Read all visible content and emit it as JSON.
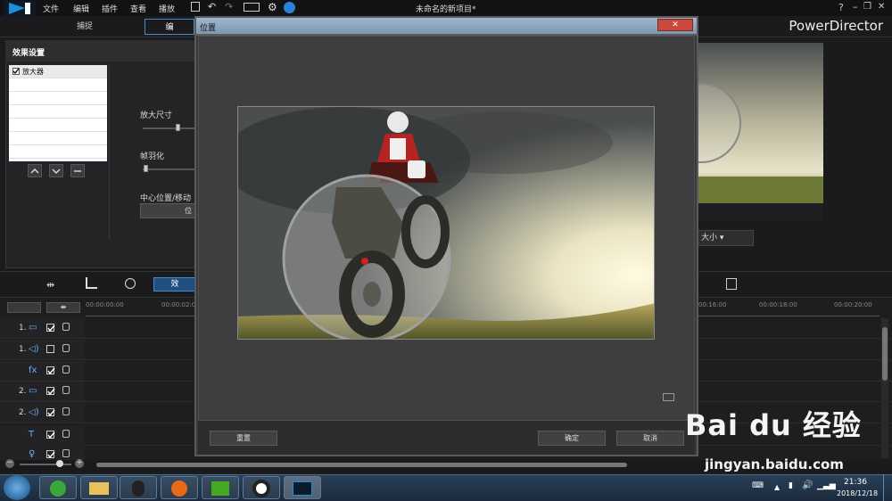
{
  "app": {
    "name": "PowerDirector",
    "title": "未命名的新项目*"
  },
  "menu": [
    "文件",
    "编辑",
    "插件",
    "查看",
    "播放"
  ],
  "tabs": [
    {
      "label": "捕捉"
    },
    {
      "label": "编"
    }
  ],
  "effects_panel": {
    "header": "效果设置",
    "list": [
      {
        "label": "放大器",
        "checked": true
      }
    ],
    "params": {
      "size_label": "放大尺寸",
      "feather_label": "帧羽化",
      "center_label": "中心位置/移动",
      "center_button": "位"
    },
    "list_buttons": [
      "up-icon",
      "down-icon",
      "remove-icon"
    ]
  },
  "preview": {
    "size_dropdown": "大小"
  },
  "toolbar": {
    "effect_tab": "效"
  },
  "timeline": {
    "ruler": [
      "00:00:00:00",
      "00:00:02:0",
      "00:16:00",
      "00:00:18:00",
      "00:00:20:00"
    ],
    "tracks": [
      {
        "num": "1.",
        "icon": "video-icon",
        "checked": true
      },
      {
        "num": "1.",
        "icon": "audio-icon",
        "checked": false
      },
      {
        "num": "",
        "icon": "fx-icon",
        "checked": true
      },
      {
        "num": "2.",
        "icon": "video-icon",
        "checked": true
      },
      {
        "num": "2.",
        "icon": "audio-icon",
        "checked": true
      },
      {
        "num": "",
        "icon": "text-icon",
        "checked": true
      },
      {
        "num": "",
        "icon": "mic-icon",
        "checked": true
      }
    ]
  },
  "dialog": {
    "title": "位置",
    "close": "✕",
    "buttons": {
      "reset": "重置",
      "ok": "确定",
      "cancel": "取消"
    }
  },
  "taskbar": {
    "time": "21:36",
    "date": "2018/12/18"
  },
  "watermark": {
    "line1": "Bai du 经验",
    "line2": "jingyan.baidu.com"
  }
}
